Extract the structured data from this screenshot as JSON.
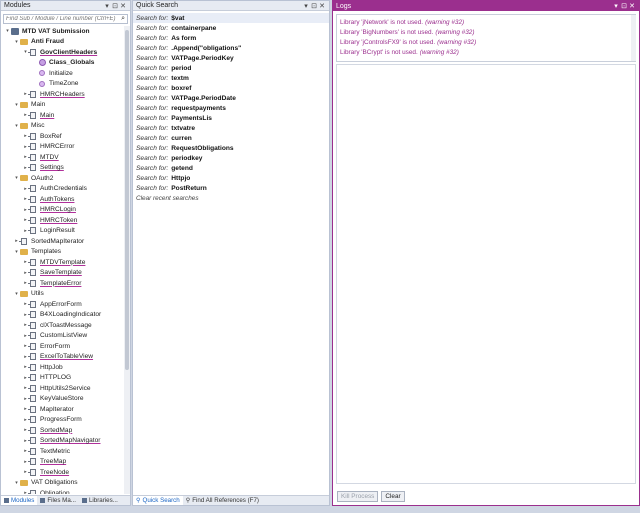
{
  "modules_panel": {
    "title": "Modules",
    "search_placeholder": "Find Sub / Module / Line number (Ctrl+E)",
    "tree": [
      {
        "label": "MTD VAT Submission",
        "indent": 0,
        "icon": "project",
        "expander": "▾",
        "bold": true,
        "underline": false
      },
      {
        "label": "Anti Fraud",
        "indent": 1,
        "icon": "folder",
        "expander": "▾",
        "bold": true,
        "underline": false
      },
      {
        "label": "GovClientHeaders",
        "indent": 2,
        "icon": "module",
        "expander": "▾",
        "bold": true,
        "underline": true
      },
      {
        "label": "Class_Globals",
        "indent": 3,
        "icon": "class",
        "expander": "",
        "bold": true,
        "underline": false
      },
      {
        "label": "Initialize",
        "indent": 3,
        "icon": "sub",
        "expander": "",
        "bold": false,
        "underline": false
      },
      {
        "label": "TimeZone",
        "indent": 3,
        "icon": "sub",
        "expander": "",
        "bold": false,
        "underline": false
      },
      {
        "label": "HMRCHeaders",
        "indent": 2,
        "icon": "module",
        "expander": "▸",
        "bold": false,
        "underline": true
      },
      {
        "label": "Main",
        "indent": 1,
        "icon": "folder",
        "expander": "▾",
        "bold": false,
        "underline": false
      },
      {
        "label": "Main",
        "indent": 2,
        "icon": "module",
        "expander": "▸",
        "bold": false,
        "underline": true
      },
      {
        "label": "Misc",
        "indent": 1,
        "icon": "folder",
        "expander": "▾",
        "bold": false,
        "underline": false
      },
      {
        "label": "BoxRef",
        "indent": 2,
        "icon": "module",
        "expander": "▸",
        "bold": false,
        "underline": false
      },
      {
        "label": "HMRCError",
        "indent": 2,
        "icon": "module",
        "expander": "▸",
        "bold": false,
        "underline": false
      },
      {
        "label": "MTDV",
        "indent": 2,
        "icon": "module",
        "expander": "▸",
        "bold": false,
        "underline": true
      },
      {
        "label": "Settings",
        "indent": 2,
        "icon": "module",
        "expander": "▸",
        "bold": false,
        "underline": true
      },
      {
        "label": "OAuth2",
        "indent": 1,
        "icon": "folder",
        "expander": "▾",
        "bold": false,
        "underline": false
      },
      {
        "label": "AuthCredentials",
        "indent": 2,
        "icon": "module",
        "expander": "▸",
        "bold": false,
        "underline": false
      },
      {
        "label": "AuthTokens",
        "indent": 2,
        "icon": "module",
        "expander": "▸",
        "bold": false,
        "underline": true
      },
      {
        "label": "HMRCLogin",
        "indent": 2,
        "icon": "module",
        "expander": "▸",
        "bold": false,
        "underline": true
      },
      {
        "label": "HMRCToken",
        "indent": 2,
        "icon": "module",
        "expander": "▸",
        "bold": false,
        "underline": true
      },
      {
        "label": "LoginResult",
        "indent": 2,
        "icon": "module",
        "expander": "▸",
        "bold": false,
        "underline": false
      },
      {
        "label": "SortedMapIterator",
        "indent": 1,
        "icon": "module",
        "expander": "▸",
        "bold": false,
        "underline": false
      },
      {
        "label": "Templates",
        "indent": 1,
        "icon": "folder",
        "expander": "▾",
        "bold": false,
        "underline": false
      },
      {
        "label": "MTDVTemplate",
        "indent": 2,
        "icon": "module",
        "expander": "▸",
        "bold": false,
        "underline": true
      },
      {
        "label": "SaveTemplate",
        "indent": 2,
        "icon": "module",
        "expander": "▸",
        "bold": false,
        "underline": true
      },
      {
        "label": "TemplateError",
        "indent": 2,
        "icon": "module",
        "expander": "▸",
        "bold": false,
        "underline": true
      },
      {
        "label": "Utils",
        "indent": 1,
        "icon": "folder",
        "expander": "▾",
        "bold": false,
        "underline": false
      },
      {
        "label": "AppErrorForm",
        "indent": 2,
        "icon": "module",
        "expander": "▸",
        "bold": false,
        "underline": false
      },
      {
        "label": "B4XLoadingIndicator",
        "indent": 2,
        "icon": "module",
        "expander": "▸",
        "bold": false,
        "underline": false
      },
      {
        "label": "clXToastMessage",
        "indent": 2,
        "icon": "module",
        "expander": "▸",
        "bold": false,
        "underline": false
      },
      {
        "label": "CustomListView",
        "indent": 2,
        "icon": "module",
        "expander": "▸",
        "bold": false,
        "underline": false
      },
      {
        "label": "ErrorForm",
        "indent": 2,
        "icon": "module",
        "expander": "▸",
        "bold": false,
        "underline": false
      },
      {
        "label": "ExcelToTableView",
        "indent": 2,
        "icon": "module",
        "expander": "▸",
        "bold": false,
        "underline": true
      },
      {
        "label": "HttpJob",
        "indent": 2,
        "icon": "module",
        "expander": "▸",
        "bold": false,
        "underline": false
      },
      {
        "label": "HTTPLOG",
        "indent": 2,
        "icon": "module",
        "expander": "▸",
        "bold": false,
        "underline": false
      },
      {
        "label": "HttpUtils2Service",
        "indent": 2,
        "icon": "module",
        "expander": "▸",
        "bold": false,
        "underline": false
      },
      {
        "label": "KeyValueStore",
        "indent": 2,
        "icon": "module",
        "expander": "▸",
        "bold": false,
        "underline": false
      },
      {
        "label": "MapIterator",
        "indent": 2,
        "icon": "module",
        "expander": "▸",
        "bold": false,
        "underline": false
      },
      {
        "label": "ProgressForm",
        "indent": 2,
        "icon": "module",
        "expander": "▸",
        "bold": false,
        "underline": false
      },
      {
        "label": "SortedMap",
        "indent": 2,
        "icon": "module",
        "expander": "▸",
        "bold": false,
        "underline": true
      },
      {
        "label": "SortedMapNavigator",
        "indent": 2,
        "icon": "module",
        "expander": "▸",
        "bold": false,
        "underline": true
      },
      {
        "label": "TextMetric",
        "indent": 2,
        "icon": "module",
        "expander": "▸",
        "bold": false,
        "underline": false
      },
      {
        "label": "TreeMap",
        "indent": 2,
        "icon": "module",
        "expander": "▸",
        "bold": false,
        "underline": true
      },
      {
        "label": "TreeNode",
        "indent": 2,
        "icon": "module",
        "expander": "▸",
        "bold": false,
        "underline": true
      },
      {
        "label": "VAT Obligations",
        "indent": 1,
        "icon": "folder",
        "expander": "▾",
        "bold": false,
        "underline": false
      },
      {
        "label": "Obligation",
        "indent": 2,
        "icon": "module",
        "expander": "▸",
        "bold": false,
        "underline": false
      }
    ],
    "tabs": [
      "Modules",
      "Files Ma...",
      "Libraries..."
    ]
  },
  "quick_search": {
    "title": "Quick Search",
    "prefix": "Search for:",
    "items": [
      "$vat",
      "containerpane",
      "As form",
      ".Append(\"obligations\"",
      "VATPage.PeriodKey",
      "period",
      "textm",
      "boxref",
      "VATPage.PeriodDate",
      "requestpayments",
      "PaymentsLis",
      "txtvatre",
      "curren",
      "RequestObligations",
      "periodkey",
      "getend",
      "Httpjo",
      "PostReturn"
    ],
    "clear_label": "Clear recent searches",
    "tabs": [
      "Quick Search",
      "Find All References (F7)"
    ]
  },
  "logs": {
    "title": "Logs",
    "warnings": [
      {
        "text": "Library 'jNetwork' is not used.",
        "code": "(warning #32)"
      },
      {
        "text": "Library 'BigNumbers' is not used.",
        "code": "(warning #32)"
      },
      {
        "text": "Library 'jControlsFX9' is not used.",
        "code": "(warning #32)"
      },
      {
        "text": "Library 'BCrypt' is not used.",
        "code": "(warning #32)"
      }
    ],
    "kill_label": "Kill Process",
    "clear_label": "Clear"
  },
  "colors": {
    "accent": "#9b2f8e",
    "panel_bg": "#ffffff",
    "app_bg": "#cfd6e3"
  }
}
